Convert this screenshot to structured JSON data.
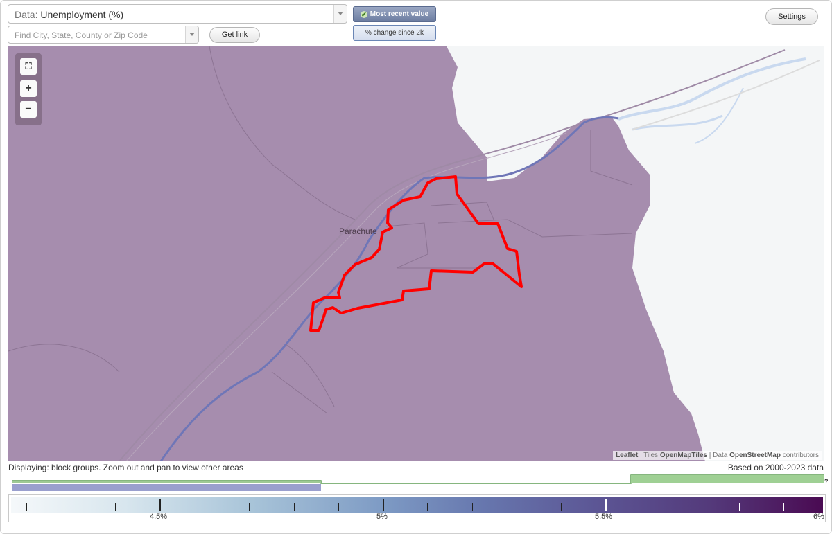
{
  "controls": {
    "data_prefix": "Data:",
    "data_value": "Unemployment (%)",
    "search_placeholder": "Find City, State, County or Zip Code",
    "get_link_label": "Get link",
    "toggle_active_label": "Most recent value",
    "toggle_inactive_label": "% change since 2k",
    "settings_label": "Settings"
  },
  "map": {
    "place_label": "Parachute",
    "zoom_fit_icon": "fullscreen-icon",
    "zoom_in_label": "+",
    "zoom_out_label": "−",
    "attribution": {
      "leaflet": "Leaflet",
      "sep1": " | ",
      "tiles_prefix": "Tiles ",
      "tiles": "OpenMapTiles",
      "sep2": " | ",
      "data_prefix": "Data ",
      "data": "OpenStreetMap",
      "suffix": " contributors"
    },
    "colors": {
      "fill": "#a68dae",
      "selection": "#ff0000",
      "water": "#c9d9ef"
    }
  },
  "status": {
    "displaying": "Displaying: block groups. Zoom out and pan to view other areas",
    "based_on": "Based on 2000-2023 data",
    "histogram_help": "?"
  },
  "legend": {
    "labels": [
      "4.5%",
      "5%",
      "5.5%",
      "6%"
    ],
    "colors": {
      "low": "#f5f8fa",
      "high": "#4a0a52"
    }
  }
}
